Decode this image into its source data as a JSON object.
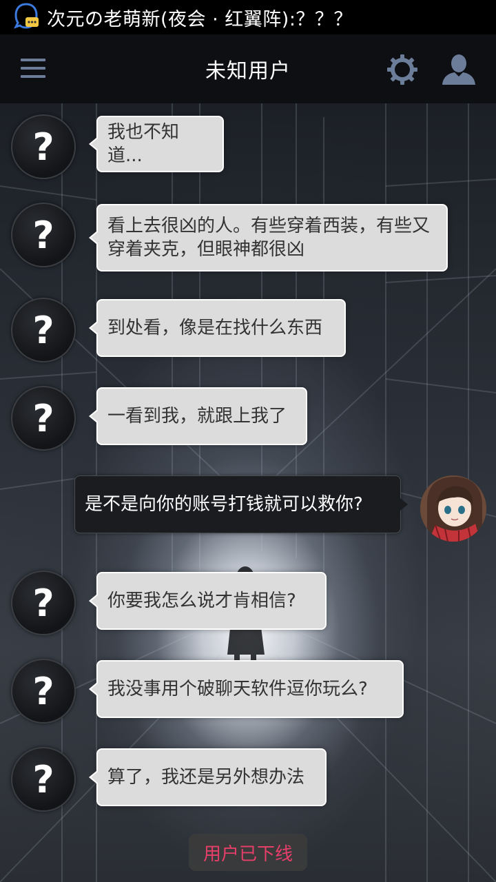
{
  "statusbar": {
    "notification_icon": "qq-chat-icon",
    "notification_text": "次元の老萌新(夜会 · 红翼阵):？？？"
  },
  "header": {
    "menu_icon": "hamburger-menu-icon",
    "title": "未知用户",
    "settings_icon": "gear-icon",
    "profile_icon": "user-icon"
  },
  "messages": [
    {
      "sender": "unknown",
      "avatar_text": "?",
      "text": "我也不知道..."
    },
    {
      "sender": "unknown",
      "avatar_text": "?",
      "text": "看上去很凶的人。有些穿着西装，有些又穿着夹克，但眼神都很凶"
    },
    {
      "sender": "unknown",
      "avatar_text": "?",
      "text": "到处看，像是在找什么东西"
    },
    {
      "sender": "unknown",
      "avatar_text": "?",
      "text": "一看到我，就跟上我了"
    },
    {
      "sender": "me",
      "text": "是不是向你的账号打钱就可以救你?"
    },
    {
      "sender": "unknown",
      "avatar_text": "?",
      "text": "你要我怎么说才肯相信?"
    },
    {
      "sender": "unknown",
      "avatar_text": "?",
      "text": "我没事用个破聊天软件逗你玩么?"
    },
    {
      "sender": "unknown",
      "avatar_text": "?",
      "text": "算了，我还是另外想办法"
    }
  ],
  "status_notice": {
    "text": "用户已下线",
    "color": "#e83e6a"
  },
  "colors": {
    "incoming_bubble": "#dcdcdc",
    "outgoing_bubble": "#1a1c20",
    "titlebar": "#0d0f12",
    "icon_accent": "#6c7d9a"
  }
}
